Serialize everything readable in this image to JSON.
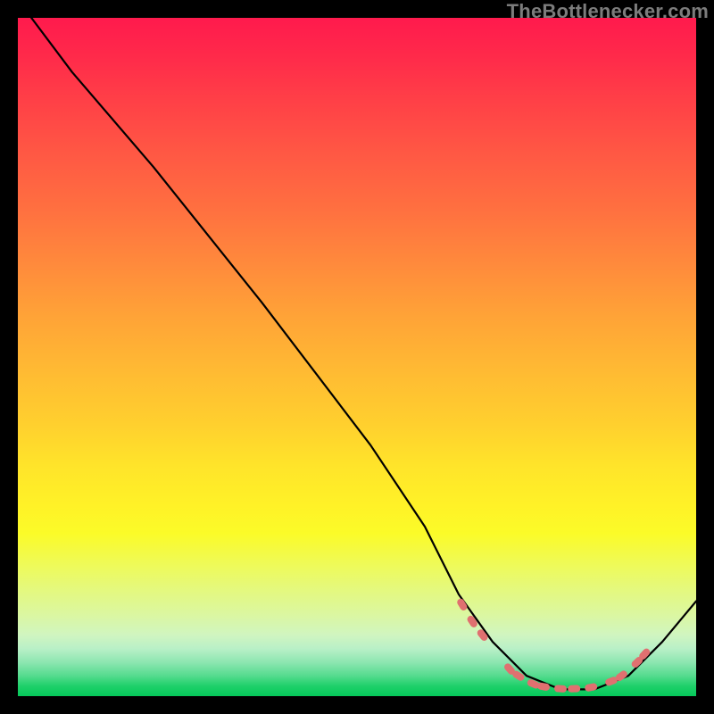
{
  "watermark": "TheBottlenecker.com",
  "chart_data": {
    "type": "line",
    "title": "",
    "xlabel": "",
    "ylabel": "",
    "xlim": [
      0,
      100
    ],
    "ylim": [
      0,
      100
    ],
    "series": [
      {
        "name": "curve",
        "x": [
          2,
          8,
          20,
          36,
          52,
          60,
          65,
          70,
          75,
          80,
          85,
          90,
          95,
          100
        ],
        "y": [
          100,
          92,
          78,
          58,
          37,
          25,
          15,
          8,
          3,
          1,
          1,
          3,
          8,
          14
        ]
      }
    ],
    "markers": {
      "color": "#e07070",
      "points_x": [
        65.5,
        67.0,
        68.5,
        72.5,
        73.8,
        76.0,
        77.5,
        80.0,
        82.0,
        84.5,
        87.5,
        89.0,
        91.3,
        92.4
      ],
      "points_y": [
        13.5,
        11.0,
        9.0,
        4.0,
        3.0,
        1.8,
        1.4,
        1.1,
        1.1,
        1.3,
        2.2,
        3.0,
        5.0,
        6.2
      ]
    },
    "background": "red-yellow-green-gradient"
  }
}
